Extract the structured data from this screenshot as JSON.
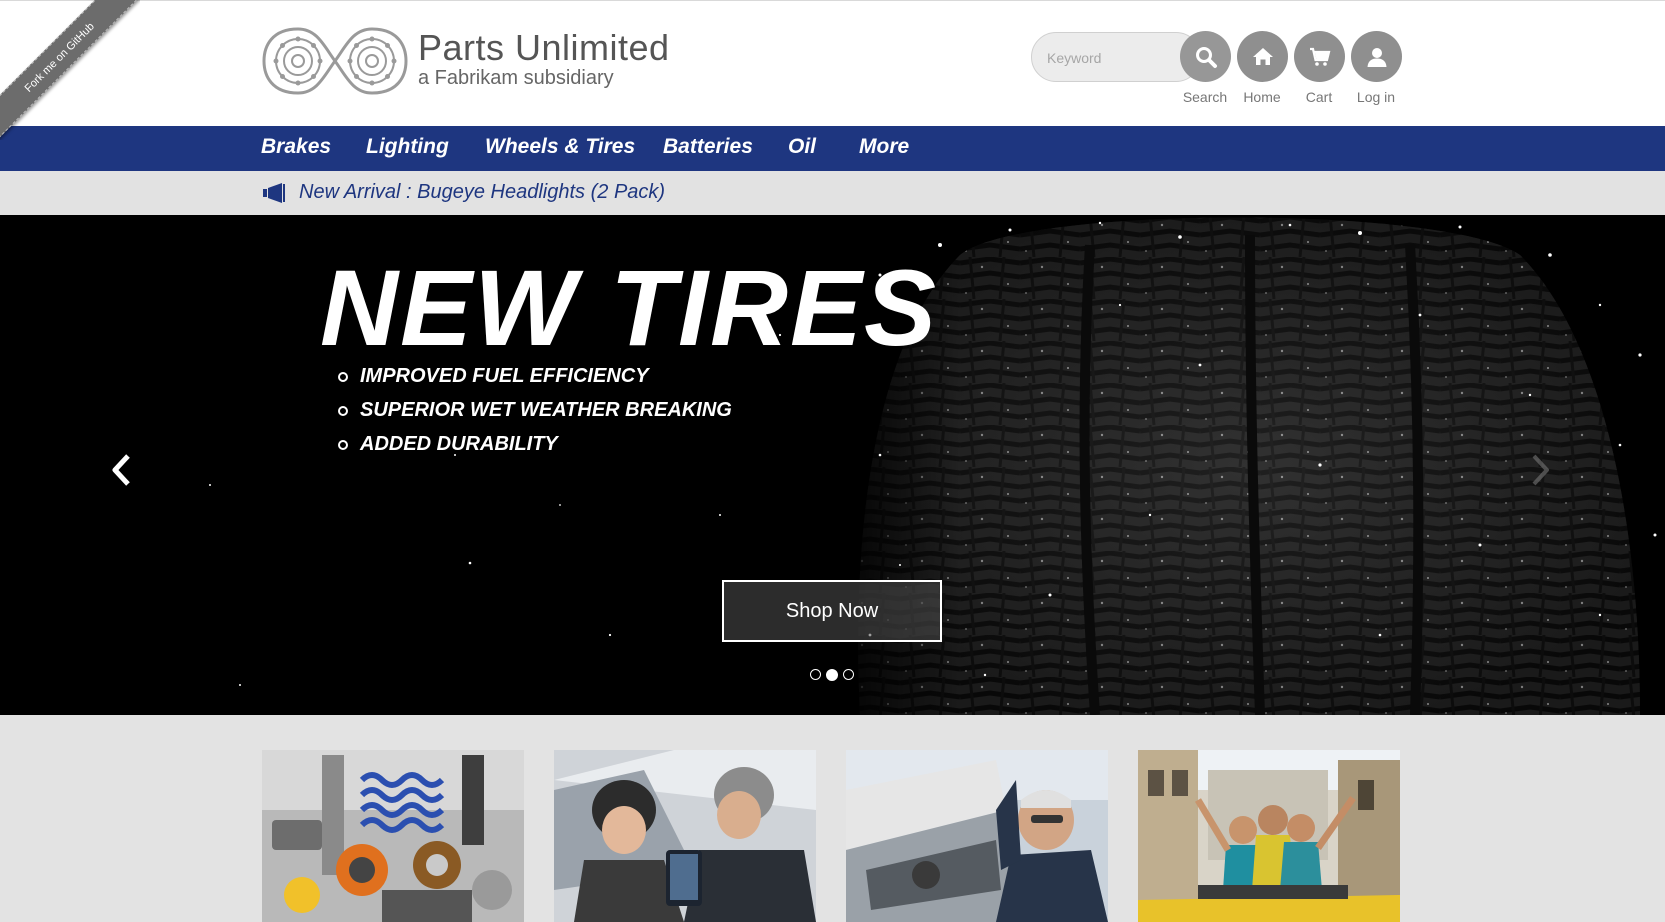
{
  "ribbon": {
    "label": "Fork me on GitHub"
  },
  "brand": {
    "title": "Parts Unlimited",
    "subtitle": "a Fabrikam subsidiary"
  },
  "search": {
    "placeholder": "Keyword"
  },
  "header_actions": [
    {
      "label": "Search",
      "icon": "search-icon"
    },
    {
      "label": "Home",
      "icon": "home-icon"
    },
    {
      "label": "Cart",
      "icon": "cart-icon"
    },
    {
      "label": "Log in",
      "icon": "user-icon"
    }
  ],
  "nav": {
    "items": [
      "Brakes",
      "Lighting",
      "Wheels & Tires",
      "Batteries",
      "Oil",
      "More"
    ]
  },
  "announcement": {
    "icon": "megaphone-icon",
    "text": "New Arrival : Bugeye Headlights (2 Pack)"
  },
  "hero": {
    "title": "NEW TIRES",
    "bullets": [
      "IMPROVED FUEL EFFICIENCY",
      "SUPERIOR WET WEATHER BREAKING",
      "ADDED DURABILITY"
    ],
    "cta": "Shop Now",
    "slides_total": 3,
    "active_slide": 2
  },
  "colors": {
    "nav_bg": "#1e3680",
    "announce_text": "#1e3680",
    "announce_bg": "#e2e2e2",
    "icon_btn": "#8f8f8f"
  },
  "tiles": [
    {
      "image": "auto-parts-photo"
    },
    {
      "image": "car-salespeople-photo"
    },
    {
      "image": "mechanic-photo"
    },
    {
      "image": "convertible-friends-photo"
    }
  ]
}
